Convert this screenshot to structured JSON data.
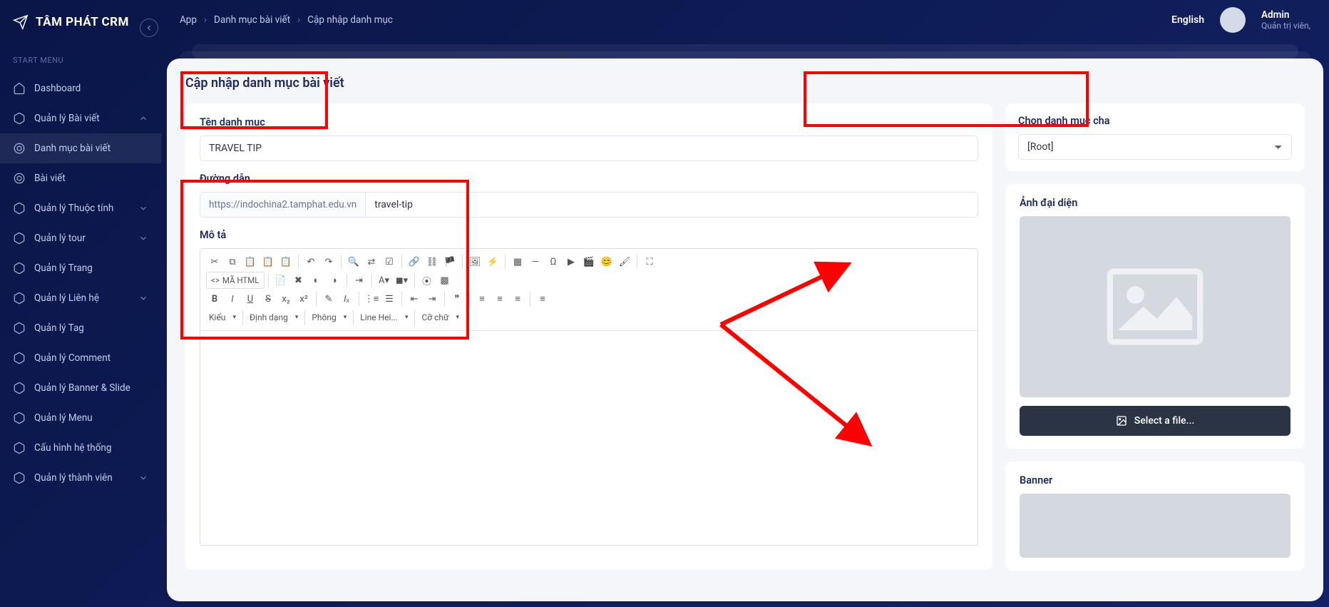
{
  "brand": "TÂM PHÁT CRM",
  "menu_label": "START MENU",
  "nav": {
    "dashboard": "Dashboard",
    "ql_baiviet": "Quản lý Bài viết",
    "danhmuc": "Danh mục bài viết",
    "baiviet": "Bài viết",
    "ql_thuoctinh": "Quản lý Thuộc tính",
    "ql_tour": "Quản lý tour",
    "ql_trang": "Quản lý Trang",
    "ql_lienhe": "Quản lý Liên hệ",
    "ql_tag": "Quản lý Tag",
    "ql_comment": "Quản lý Comment",
    "ql_banner": "Quản lý Banner & Slide",
    "ql_menu": "Quản lý Menu",
    "cauhinh": "Cấu hình hệ thống",
    "ql_thanhvien": "Quản lý thành viên"
  },
  "breadcrumb": {
    "app": "App",
    "lv1": "Danh mục bài viết",
    "lv2": "Cập nhập danh mục"
  },
  "lang": "English",
  "user": {
    "name": "Admin",
    "role": "Quản trị viên,"
  },
  "page_title": "Cập nhập danh mục bài viết",
  "form": {
    "name_label": "Tên danh mục",
    "name_value": "TRAVEL TIP",
    "path_label": "Đường dẫn",
    "path_prefix": "https://indochina2.tamphat.edu.vn",
    "path_value": "travel-tip",
    "desc_label": "Mô tả"
  },
  "editor": {
    "source_btn": "MÃ HTML",
    "style": "Kiểu",
    "format": "Định dạng",
    "font": "Phông",
    "lineheight": "Line Hei...",
    "size": "Cỡ chữ"
  },
  "right": {
    "parent_label": "Chọn danh mục cha",
    "parent_value": "[Root]",
    "avatar_label": "Ảnh đại diện",
    "select_file": "Select a file...",
    "banner_label": "Banner"
  }
}
